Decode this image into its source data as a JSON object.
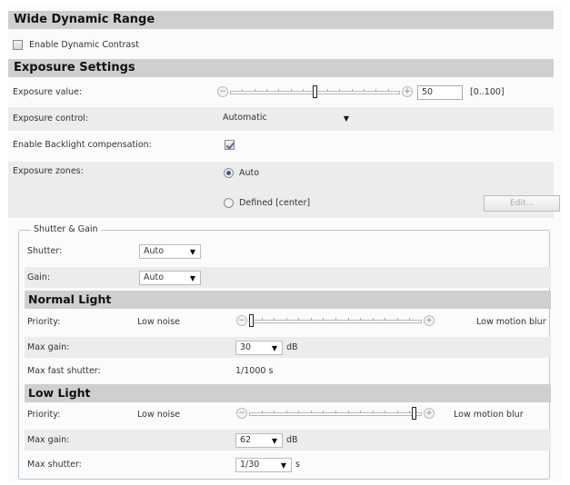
{
  "wide_dynamic_range": {
    "title": "Wide Dynamic Range",
    "enable_dynamic_contrast_label": "Enable Dynamic Contrast",
    "enable_dynamic_contrast_checked": false
  },
  "exposure_settings": {
    "title": "Exposure Settings",
    "exposure_value": {
      "label": "Exposure value:",
      "value": "50",
      "range": "[0..100]",
      "slider_fraction": 0.5
    },
    "exposure_control": {
      "label": "Exposure control:",
      "value": "Automatic"
    },
    "backlight": {
      "label": "Enable Backlight compensation:",
      "checked": true
    },
    "exposure_zones": {
      "label": "Exposure zones:",
      "options": [
        {
          "label": "Auto",
          "selected": true
        },
        {
          "label": "Defined [center]",
          "selected": false
        }
      ],
      "edit_label": "Edit..."
    }
  },
  "shutter_gain": {
    "legend": "Shutter & Gain",
    "shutter": {
      "label": "Shutter:",
      "value": "Auto"
    },
    "gain": {
      "label": "Gain:",
      "value": "Auto"
    }
  },
  "normal_light": {
    "title": "Normal Light",
    "priority": {
      "label": "Priority:",
      "low": "Low noise",
      "high": "Low motion blur",
      "slider_fraction": 0.0
    },
    "max_gain": {
      "label": "Max gain:",
      "value": "30",
      "unit": "dB"
    },
    "max_fast_shutter": {
      "label": "Max fast shutter:",
      "value": "1/1000 s"
    }
  },
  "low_light": {
    "title": "Low Light",
    "priority": {
      "label": "Priority:",
      "low": "Low noise",
      "high": "Low motion blur",
      "slider_fraction": 0.97
    },
    "max_gain": {
      "label": "Max gain:",
      "value": "62",
      "unit": "dB"
    },
    "max_shutter": {
      "label": "Max shutter:",
      "value": "1/30",
      "unit": "s"
    }
  }
}
